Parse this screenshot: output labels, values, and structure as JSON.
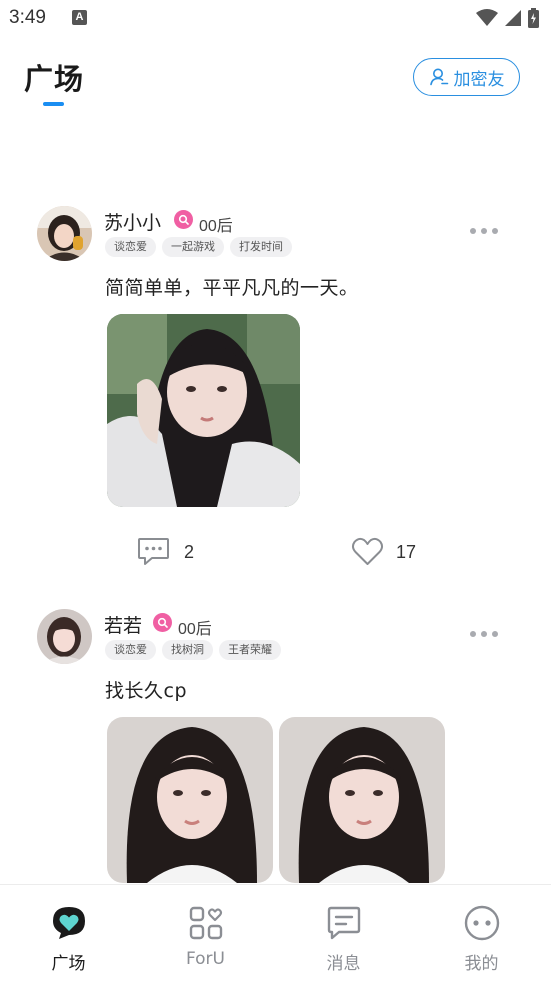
{
  "status_bar": {
    "time": "3:49",
    "notification_icon": "a-icon"
  },
  "header": {
    "title": "广场",
    "add_friend_label": "加密友"
  },
  "posts": [
    {
      "user_name": "苏小小",
      "age_tag": "00后",
      "tags": [
        "谈恋爱",
        "一起游戏",
        "打发时间"
      ],
      "text": "简简单单，平平凡凡的一天。",
      "comment_count": "2",
      "like_count": "17"
    },
    {
      "user_name": "若若",
      "age_tag": "00后",
      "tags": [
        "谈恋爱",
        "找树洞",
        "王者荣耀"
      ],
      "text": "找长久cp"
    }
  ],
  "nav": [
    {
      "label": "广场",
      "icon": "heart-chat-icon",
      "active": true
    },
    {
      "label": "ForU",
      "icon": "grid-heart-icon",
      "active": false
    },
    {
      "label": "消息",
      "icon": "message-icon",
      "active": false
    },
    {
      "label": "我的",
      "icon": "face-icon",
      "active": false
    }
  ],
  "colors": {
    "accent": "#1a8ef2",
    "vip": "#f05fa3",
    "nav_active": "#5ed5d0"
  }
}
